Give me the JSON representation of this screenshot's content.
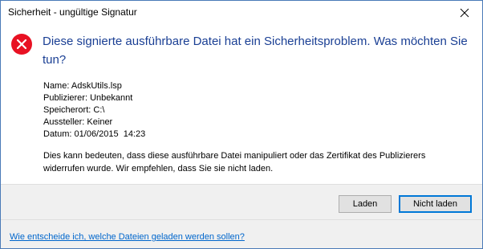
{
  "window": {
    "title": "Sicherheit - ungültige Signatur",
    "close_icon": "close-icon"
  },
  "message": {
    "icon": "error-icon",
    "headline": "Diese signierte ausführbare Datei hat ein Sicherheitsproblem.  Was möchten Sie tun?",
    "details": [
      {
        "label": "Name:",
        "value": "AdskUtils.lsp"
      },
      {
        "label": "Publizierer:",
        "value": "Unbekannt"
      },
      {
        "label": "Speicherort:",
        "value": "C:\\"
      },
      {
        "label": "Aussteller:",
        "value": "Keiner"
      },
      {
        "label": "Datum:",
        "value": "01/06/2015  14:23"
      }
    ],
    "warning": "Dies kann bedeuten, dass diese ausführbare Datei manipuliert oder das Zertifikat des Publizierers widerrufen wurde. Wir empfehlen, dass Sie sie nicht laden."
  },
  "buttons": {
    "load": "Laden",
    "do_not_load": "Nicht laden"
  },
  "footer": {
    "help_link": "Wie entscheide ich, welche Dateien geladen werden sollen?"
  },
  "colors": {
    "headline": "#1a3f94",
    "error_icon": "#e81123",
    "link": "#0066cc",
    "button_bar": "#f0f0f0",
    "default_button_border": "#0078d7"
  }
}
